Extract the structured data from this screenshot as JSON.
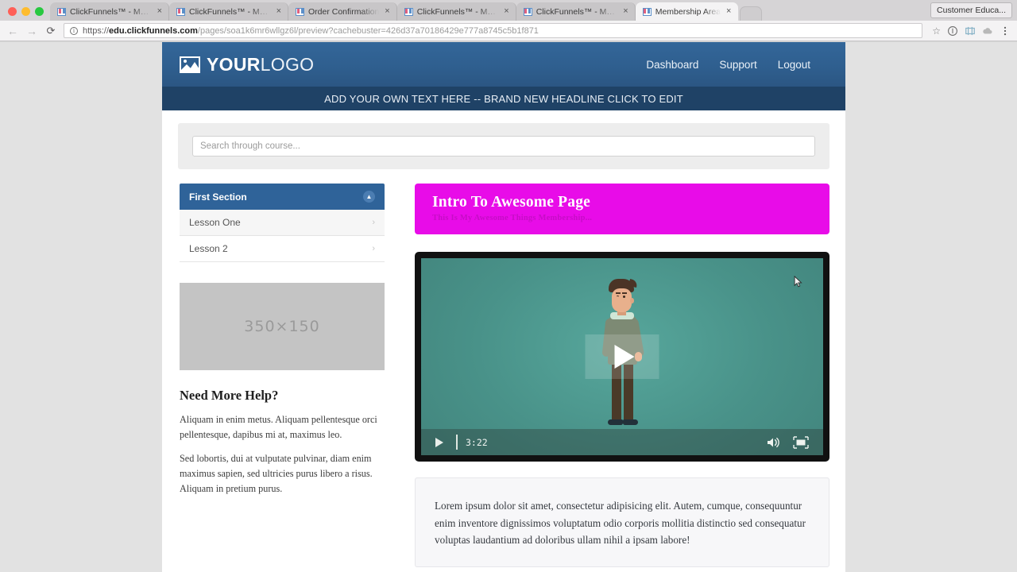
{
  "browser": {
    "tabs": [
      {
        "title": "ClickFunnels™ - Marketing F...",
        "active": false
      },
      {
        "title": "ClickFunnels™ - Marketing F...",
        "active": false
      },
      {
        "title": "Order Confirmation",
        "active": false
      },
      {
        "title": "ClickFunnels™ - Marketing F...",
        "active": false
      },
      {
        "title": "ClickFunnels™ - Marketing F...",
        "active": false
      },
      {
        "title": "Membership Area",
        "active": true
      }
    ],
    "close_label": "×",
    "profile_label": "Customer Educa...",
    "toolbar": {
      "back": "←",
      "forward": "→",
      "reload": "⟳",
      "star": "☆",
      "url_scheme": "https://",
      "url_host": "edu.clickfunnels.com",
      "url_path": "/pages/soa1k6mr6wllgz6l/preview?cachebuster=426d37a70186429e777a8745c5b1f871"
    }
  },
  "site": {
    "logo": {
      "bold": "YOUR",
      "light": "LOGO"
    },
    "nav": [
      {
        "label": "Dashboard"
      },
      {
        "label": "Support"
      },
      {
        "label": "Logout"
      }
    ],
    "headline": "ADD YOUR OWN TEXT HERE -- BRAND NEW HEADLINE CLICK TO EDIT"
  },
  "search": {
    "placeholder": "Search through course...",
    "value": ""
  },
  "sidebar": {
    "section_title": "First Section",
    "collapse_icon": "▲",
    "lessons": [
      {
        "label": "Lesson One",
        "active": true,
        "chevron": "›"
      },
      {
        "label": "Lesson 2",
        "active": false,
        "chevron": "›"
      }
    ],
    "placeholder_image_label": "350×150",
    "help_title": "Need More Help?",
    "help_paragraphs": [
      "Aliquam in enim metus. Aliquam pellentesque orci pellentesque, dapibus mi at, maximus leo.",
      "Sed lobortis, dui at vulputate pulvinar, diam enim maximus sapien, sed ultricies purus libero a risus. Aliquam in pretium purus."
    ]
  },
  "main": {
    "title_card": {
      "title": "Intro To Awesome Page",
      "subtitle": "This Is My Awesome Things Membership...",
      "background_color": "#e80ce8"
    },
    "video": {
      "time": "3:22",
      "play_label": "Play",
      "volume_label": "Volume",
      "fullscreen_label": "Fullscreen"
    },
    "content_paragraph": "Lorem ipsum dolor sit amet, consectetur adipisicing elit. Autem, cumque, consequuntur enim inventore dignissimos voluptatum odio corporis mollitia distinctio sed consequatur voluptas laudantium ad doloribus ullam nihil a ipsam labore!"
  }
}
